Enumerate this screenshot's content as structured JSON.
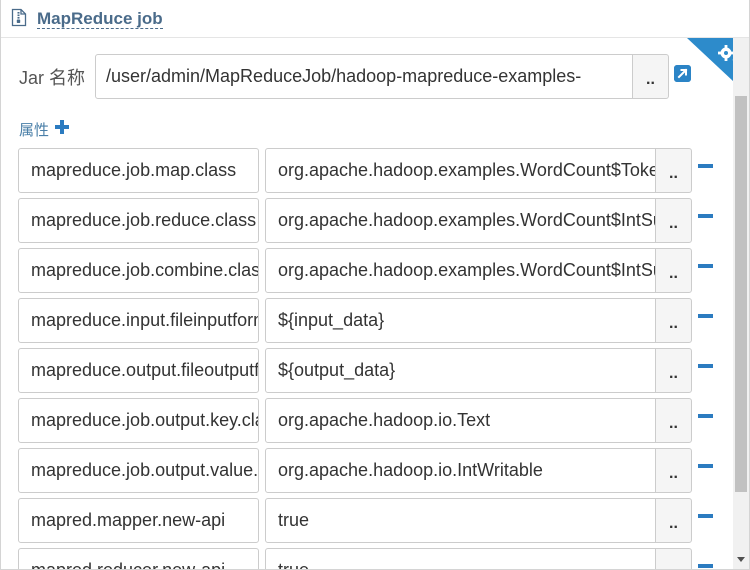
{
  "header": {
    "title": "MapReduce job",
    "icon": "file-icon"
  },
  "jar": {
    "label": "Jar 名称",
    "value": "/user/admin/MapReduceJob/hadoop-mapreduce-examples-",
    "browse_label": ".."
  },
  "properties": {
    "label": "属性",
    "rows": [
      {
        "key": "mapreduce.job.map.class",
        "value": "org.apache.hadoop.examples.WordCount$TokenizerMapper",
        "btn": ".."
      },
      {
        "key": "mapreduce.job.reduce.class",
        "value": "org.apache.hadoop.examples.WordCount$IntSumReducer",
        "btn": ".."
      },
      {
        "key": "mapreduce.job.combine.class",
        "value": "org.apache.hadoop.examples.WordCount$IntSumReducer",
        "btn": ".."
      },
      {
        "key": "mapreduce.input.fileinputformat.inputdir",
        "value": "${input_data}",
        "btn": ".."
      },
      {
        "key": "mapreduce.output.fileoutputformat.outputdir",
        "value": "${output_data}",
        "btn": ".."
      },
      {
        "key": "mapreduce.job.output.key.class",
        "value": "org.apache.hadoop.io.Text",
        "btn": ".."
      },
      {
        "key": "mapreduce.job.output.value.class",
        "value": "org.apache.hadoop.io.IntWritable",
        "btn": ".."
      },
      {
        "key": "mapred.mapper.new-api",
        "value": "true",
        "btn": ".."
      },
      {
        "key": "mapred.reducer.new-api",
        "value": "true",
        "btn": ".."
      }
    ]
  },
  "colors": {
    "accent": "#2b7bc0",
    "corner": "#2d8bcb",
    "title": "#4a6b8a"
  }
}
